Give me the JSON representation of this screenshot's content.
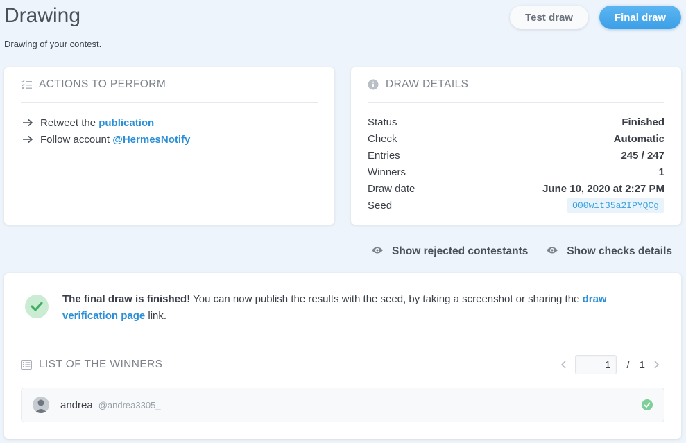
{
  "header": {
    "title": "Drawing",
    "subtitle": "Drawing of your contest.",
    "test_draw_label": "Test draw",
    "final_draw_label": "Final draw"
  },
  "actions": {
    "title": "Actions to perform",
    "items": [
      {
        "prefix": "Retweet the ",
        "link": "publication"
      },
      {
        "prefix": "Follow account ",
        "link": "@HermesNotify"
      }
    ]
  },
  "details": {
    "title": "Draw details",
    "rows": [
      {
        "label": "Status",
        "value": "Finished"
      },
      {
        "label": "Check",
        "value": "Automatic"
      },
      {
        "label": "Entries",
        "value": "245 / 247"
      },
      {
        "label": "Winners",
        "value": "1"
      },
      {
        "label": "Draw date",
        "value": "June 10, 2020 at 2:27 PM"
      },
      {
        "label": "Seed",
        "value": "O00wit35a2IPYQCg"
      }
    ]
  },
  "toggles": {
    "rejected_label": "Show rejected contestants",
    "checks_label": "Show checks details"
  },
  "notice": {
    "bold": "The final draw is finished!",
    "text": " You can now publish the results with the seed, by taking a screenshot or sharing the ",
    "link": "draw verification page",
    "suffix": " link."
  },
  "winners": {
    "title": "List of the winners",
    "page_current": "1",
    "page_separator": "/",
    "page_total": "1",
    "list": [
      {
        "name": "andrea",
        "handle": "@andrea3305_"
      }
    ]
  },
  "colors": {
    "background": "#eef4fb",
    "accent": "#2a8fd6",
    "success": "#7fcf98"
  }
}
